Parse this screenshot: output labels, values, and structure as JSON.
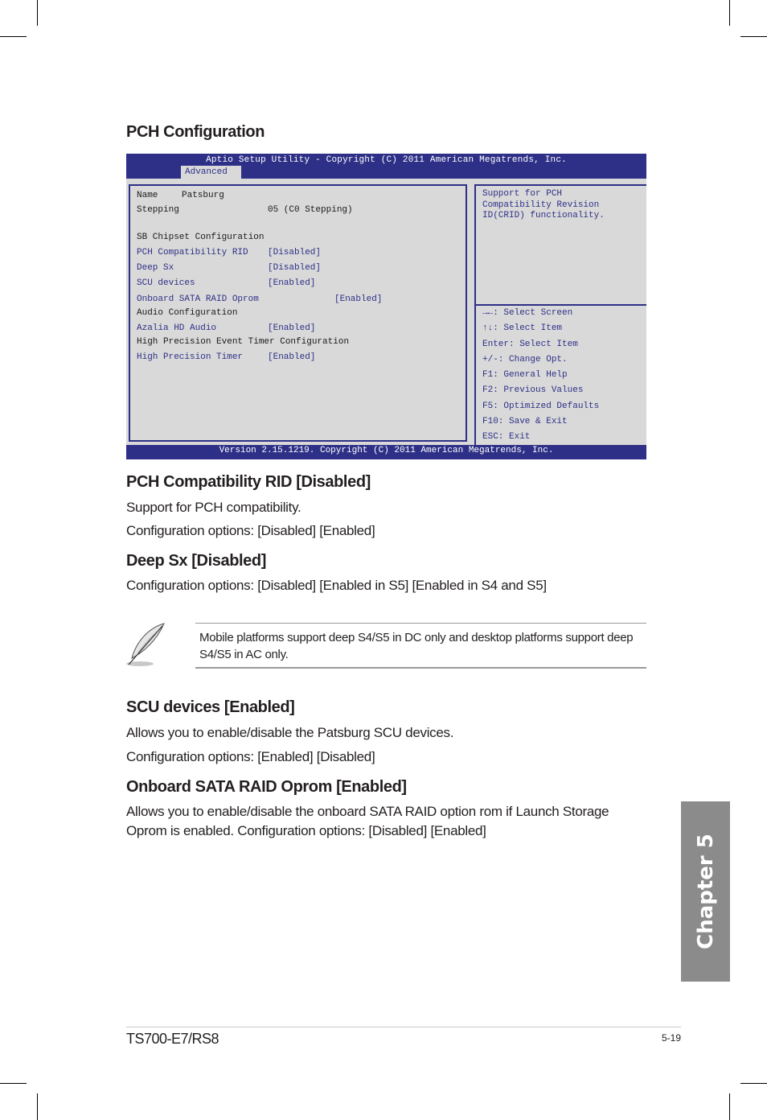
{
  "page_title": "PCH Configuration",
  "bios": {
    "title": "Aptio Setup Utility - Copyright (C) 2011 American Megatrends, Inc.",
    "active_tab": "Advanced",
    "version": "Version 2.15.1219. Copyright (C) 2011 American Megatrends, Inc.",
    "info": [
      {
        "label": "Name",
        "value": "Patsburg"
      },
      {
        "label": "Stepping",
        "value": "05 (C0 Stepping)"
      }
    ],
    "section_sb": "SB Chipset Configuration",
    "items": [
      {
        "label": "PCH Compatibility RID",
        "value": "[Disabled]"
      },
      {
        "label": "Deep Sx",
        "value": "[Disabled]"
      },
      {
        "label": "SCU devices",
        "value": "[Enabled]"
      },
      {
        "label": "Onboard SATA RAID Oprom",
        "value": "[Enabled]"
      }
    ],
    "section_audio": "Audio Configuration",
    "audio_item": {
      "label": "Azalia HD Audio",
      "value": "[Enabled]"
    },
    "section_hpet": "High Precision Event Timer Configuration",
    "hpet_item": {
      "label": "High Precision Timer",
      "value": "[Enabled]"
    },
    "help_text": "Support for PCH\nCompatibility Revision\nID(CRID) functionality.",
    "keys": [
      "→←: Select Screen",
      "↑↓: Select Item",
      "Enter: Select Item",
      "+/-: Change Opt.",
      "F1: General Help",
      "F2: Previous Values",
      "F5: Optimized Defaults",
      "F10: Save & Exit",
      "ESC: Exit"
    ]
  },
  "sections": [
    {
      "heading": "PCH Compatibility RID [Disabled]",
      "lines": [
        "Support for PCH compatibility.",
        "Configuration options: [Disabled] [Enabled]"
      ]
    },
    {
      "heading": "Deep Sx [Disabled]",
      "lines": [
        "Configuration options: [Disabled] [Enabled in S5] [Enabled in S4 and S5]"
      ]
    },
    {
      "heading": "SCU devices [Enabled]",
      "lines": [
        "Allows you to enable/disable the Patsburg SCU devices.",
        "Configuration options: [Enabled] [Disabled]"
      ]
    },
    {
      "heading": "Onboard SATA RAID Oprom [Enabled]",
      "lines": [
        "Allows you to enable/disable the onboard SATA RAID option rom if Launch Storage Oprom is enabled. Configuration options: [Disabled] [Enabled]"
      ]
    }
  ],
  "note": {
    "icon": "feather-pen-icon",
    "text": "Mobile platforms support deep S4/S5 in DC only and desktop platforms support deep S4/S5 in AC only."
  },
  "chapter_tab": "Chapter 5",
  "footer": {
    "model": "TS700-E7/RS8",
    "page_number": "5-19"
  },
  "colors": {
    "bios_blue": "#2e3087",
    "bios_gray": "#d9d9d9",
    "chapter_tab_gray": "#8c8b8b"
  }
}
